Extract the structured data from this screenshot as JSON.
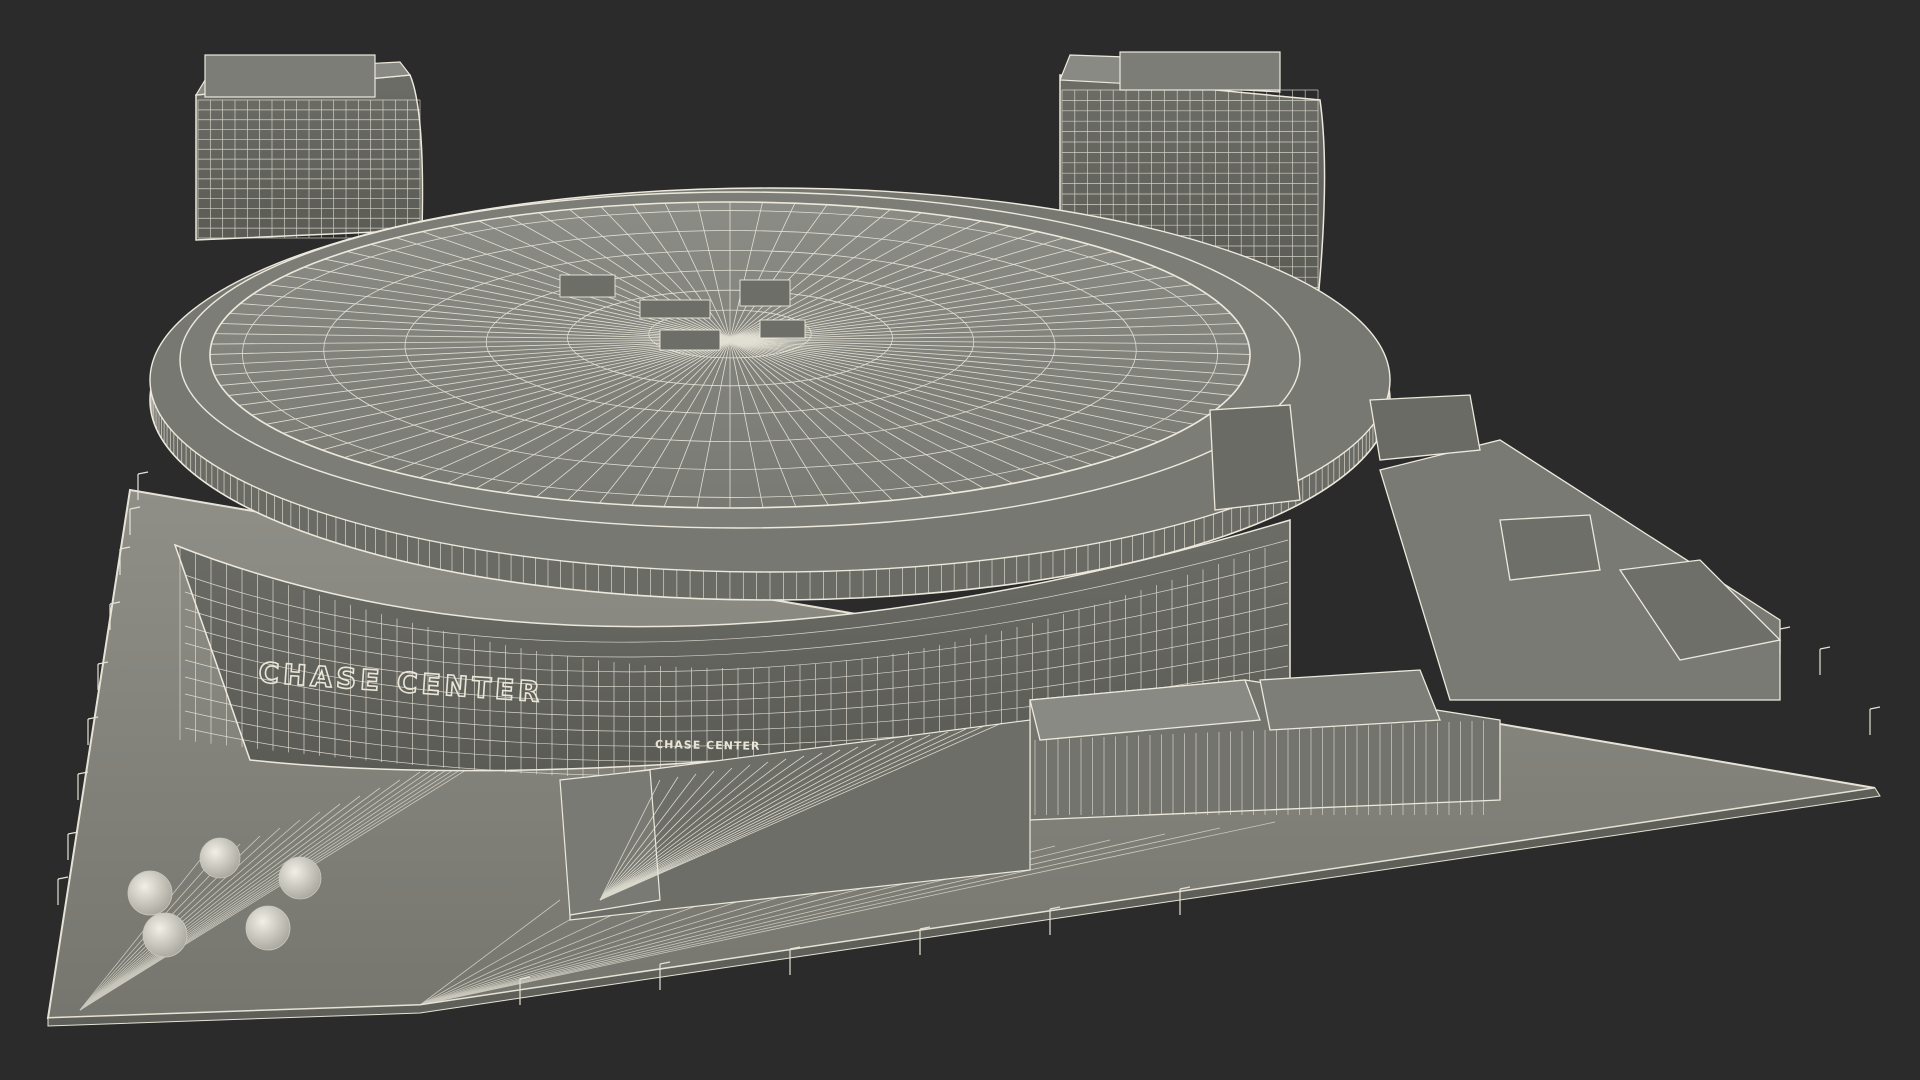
{
  "scene": {
    "background_color": "#2b2b2b",
    "model_color": "#8a8a84",
    "wire_color": "#ece9dc",
    "ball_color": "#dedbd0"
  },
  "signage": {
    "main": "CHASE CENTER",
    "entrance": "CHASE CENTER"
  }
}
